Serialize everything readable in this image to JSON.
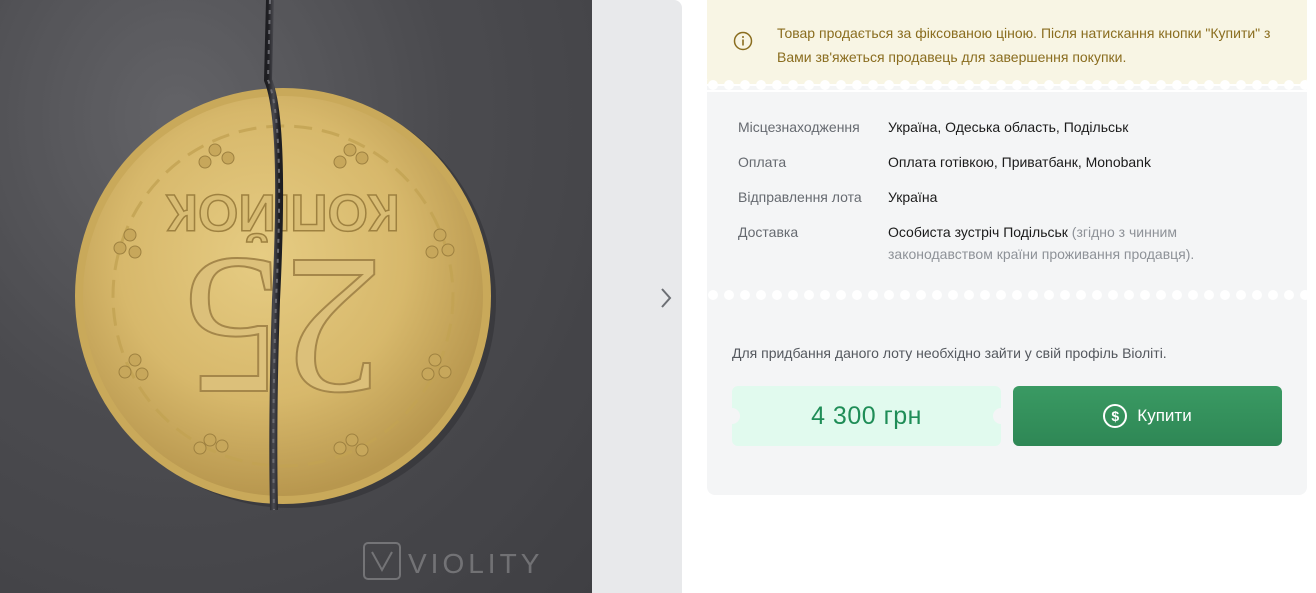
{
  "notice": {
    "icon": "info-icon",
    "text": "Товар продається за фіксованою ціною. Після натискання кнопки \"Купити\" з Вами зв'яжеться продавець для завершення покупки.",
    "color": "#8a6d1f",
    "background": "#f8f5e4"
  },
  "gallery": {
    "next_icon": "chevron-right-icon",
    "watermark": "VIOLITY",
    "coin": {
      "top_text": "КОПІЙОК",
      "denomination": "25"
    }
  },
  "details": [
    {
      "label": "Місцезнаходження",
      "value": "Україна, Одеська область, Подільськ"
    },
    {
      "label": "Оплата",
      "value": "Оплата готівкою, Приватбанк, Monobank"
    },
    {
      "label": "Відправлення лота",
      "value": "Україна"
    },
    {
      "label": "Доставка",
      "value": "Особиста зустріч Подільськ",
      "note": "(згідно з чинним законодавством країни проживання продавця)."
    }
  ],
  "purchase": {
    "hint": "Для придбання даного лоту необхідно зайти у свій профіль Віоліті.",
    "price": "4 300 грн",
    "buy_label": "Купити",
    "buy_icon": "dollar-circle-icon",
    "price_color": "#1f8d57",
    "button_color": "#2e8755"
  }
}
